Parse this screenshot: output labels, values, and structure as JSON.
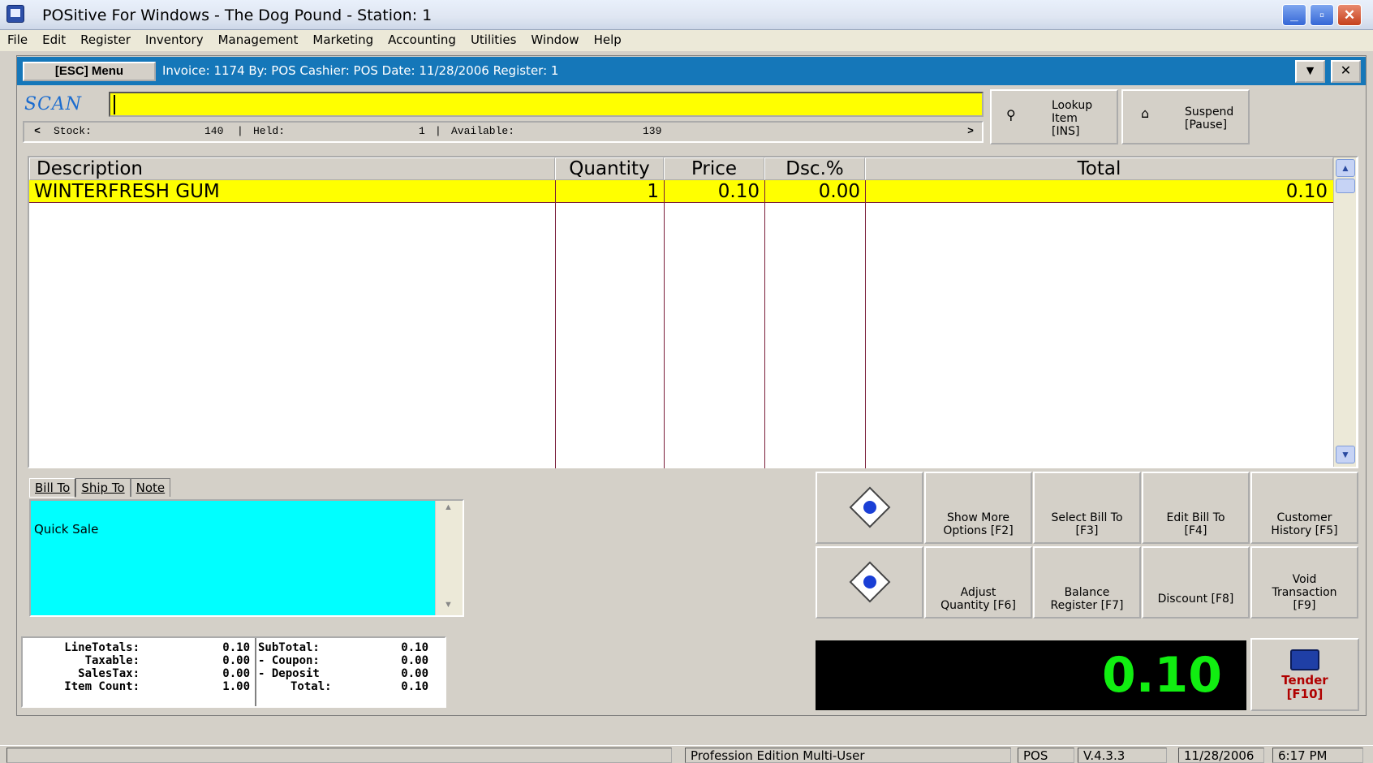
{
  "window": {
    "title": "POSitive For Windows - The Dog Pound - Station: 1",
    "minimize": "_",
    "restore": "▫",
    "close": "✕"
  },
  "menu": [
    "File",
    "Edit",
    "Register",
    "Inventory",
    "Management",
    "Marketing",
    "Accounting",
    "Utilities",
    "Window",
    "Help"
  ],
  "infobar": {
    "esc_label": "[ESC] Menu",
    "invoice_text": "Invoice: 1174  By: POS  Cashier: POS  Date: 11/28/2006  Register: 1",
    "dropdown_glyph": "▼",
    "close_glyph": "✕"
  },
  "scan": {
    "label": "SCAN",
    "value": ""
  },
  "stock": {
    "left_arrow": "<",
    "right_arrow": ">",
    "stock_label": "Stock:",
    "stock_value": "140",
    "held_label": "Held:",
    "held_value": "1",
    "available_label": "Available:",
    "available_value": "139",
    "sep": "|"
  },
  "buttons": {
    "lookup": {
      "line1": "Lookup",
      "line2": "Item",
      "line3": "[INS]"
    },
    "suspend": {
      "line1": "Suspend",
      "line2": "[Pause]"
    }
  },
  "grid": {
    "headers": {
      "description": "Description",
      "quantity": "Quantity",
      "price": "Price",
      "discount": "Dsc.%",
      "total": "Total"
    },
    "rows": [
      {
        "description": "WINTERFRESH GUM",
        "quantity": "1",
        "price": "0.10",
        "discount": "0.00",
        "total": "0.10"
      }
    ]
  },
  "tabs": [
    "Bill To",
    "Ship To",
    "Note"
  ],
  "bill_to": {
    "text": "Quick Sale"
  },
  "functions": {
    "show_more": {
      "l1": "Show More",
      "l2": "Options [F2]"
    },
    "select_bill": {
      "l1": "Select Bill To",
      "l2": "[F3]"
    },
    "edit_bill": {
      "l1": "Edit Bill To",
      "l2": "[F4]"
    },
    "customer_history": {
      "l1": "Customer",
      "l2": "History [F5]"
    },
    "adjust_qty": {
      "l1": "Adjust",
      "l2": "Quantity [F6]"
    },
    "balance_register": {
      "l1": "Balance",
      "l2": "Register [F7]"
    },
    "discount": {
      "l1": "Discount [F8]"
    },
    "void": {
      "l1": "Void",
      "l2": "Transaction",
      "l3": "[F9]"
    }
  },
  "totals": {
    "line_totals_label": "LineTotals:",
    "line_totals": "0.10",
    "taxable_label": "Taxable:",
    "taxable": "0.00",
    "sales_tax_label": "SalesTax:",
    "sales_tax": "0.00",
    "item_count_label": "Item Count:",
    "item_count": "1.00",
    "subtotal_label": "SubTotal:",
    "subtotal": "0.10",
    "coupon_label": "- Coupon:",
    "coupon": "0.00",
    "deposit_label": "- Deposit",
    "deposit": "0.00",
    "total_label": "Total:",
    "total": "0.10"
  },
  "display_total": "0.10",
  "tender": {
    "l1": "Tender",
    "l2": "[F10]"
  },
  "status": {
    "edition": "Profession Edition Multi-User",
    "user": "POS",
    "version": "V.4.3.3",
    "date": "11/28/2006",
    "time": "6:17 PM"
  },
  "colors": {
    "accent": "#1577b9",
    "scan_bg": "#ffff00",
    "bill_bg": "#00ffff",
    "display_fg": "#11ee11"
  }
}
